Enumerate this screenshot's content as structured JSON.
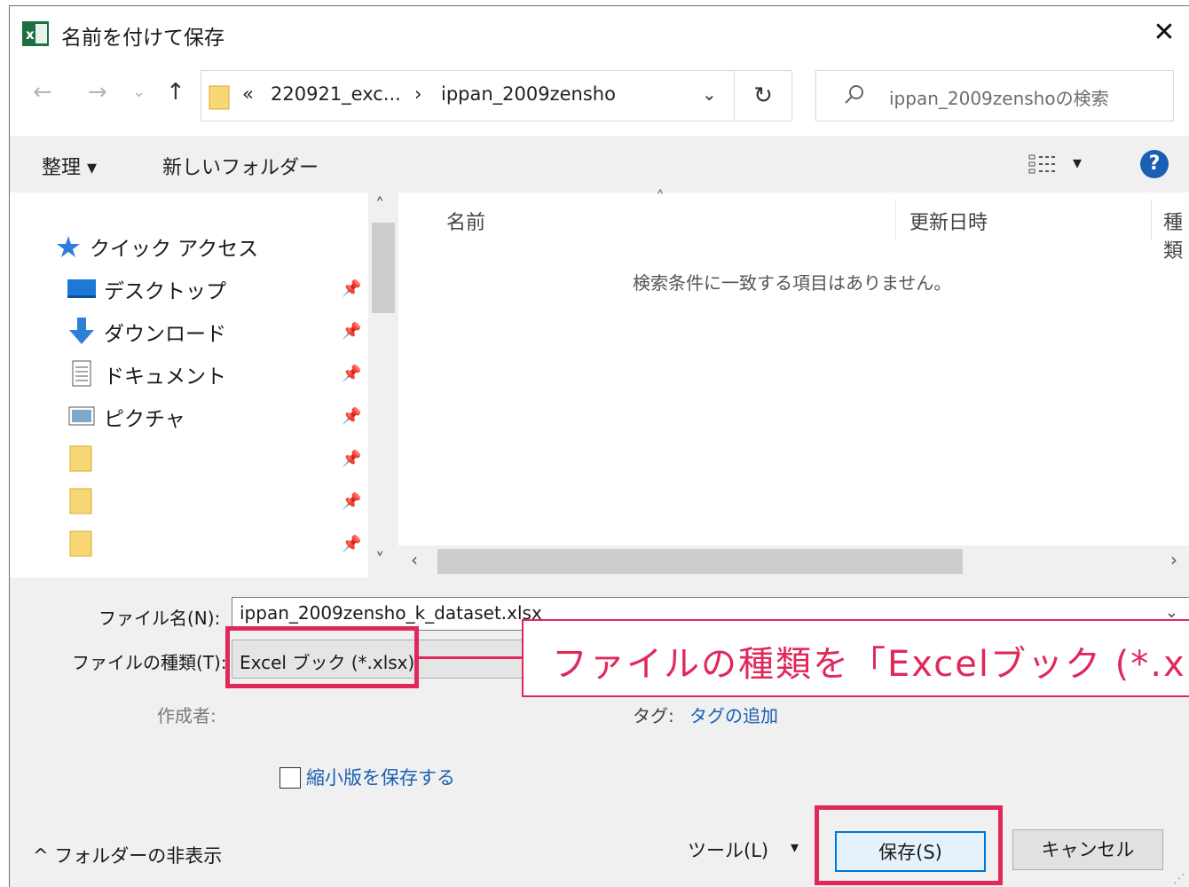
{
  "window": {
    "title": "名前を付けて保存",
    "app_icon_letter": "x",
    "close_glyph": "✕"
  },
  "address": {
    "back": "←",
    "forward": "→",
    "history_caret": "⌄",
    "up": "↑",
    "crumb_prefix": "«",
    "crumb_1": "220921_exc...",
    "crumb_sep": "›",
    "crumb_2": "ippan_2009zensho",
    "dropdown": "⌄",
    "refresh": "↻",
    "search_placeholder": "ippan_2009zenshoの検索"
  },
  "toolbar": {
    "organize": "整理 ▾",
    "new_folder": "新しいフォルダー",
    "view_caret": "▾",
    "help": "?"
  },
  "nav": {
    "quick_access": "クイック アクセス",
    "items": [
      {
        "label": "デスクトップ",
        "icon": "desktop-icon"
      },
      {
        "label": "ダウンロード",
        "icon": "download-icon"
      },
      {
        "label": "ドキュメント",
        "icon": "document-icon"
      },
      {
        "label": "ピクチャ",
        "icon": "pictures-icon"
      },
      {
        "label": "",
        "icon": "folder-icon"
      },
      {
        "label": "",
        "icon": "folder-icon"
      },
      {
        "label": "",
        "icon": "folder-icon"
      }
    ],
    "pin_glyph": "📌",
    "scroll_up": "˄",
    "scroll_down": "˅"
  },
  "filelist": {
    "col_name": "名前",
    "col_date": "更新日時",
    "col_type": "種類",
    "sort_glyph": "˄",
    "empty_message": "検索条件に一致する項目はありません。",
    "scroll_left": "‹",
    "scroll_right": "›"
  },
  "form": {
    "filename_label": "ファイル名(N):",
    "filename_value": "ippan_2009zensho_k_dataset.xlsx",
    "filetype_label": "ファイルの種類(T):",
    "filetype_value": "Excel ブック (*.xlsx)",
    "author_label": "作成者:",
    "tag_label": "タグ:",
    "tag_link": "タグの追加",
    "thumbnail_label": "縮小版を保存する",
    "hide_folders": "^ フォルダーの非表示",
    "tools": "ツール(L)",
    "tools_caret": "▾",
    "save": "保存(S)",
    "cancel": "キャンセル"
  },
  "annotation": {
    "callout_text": "ファイルの種類を「Excelブック (*.xlsx)」",
    "color": "#e0285a"
  }
}
